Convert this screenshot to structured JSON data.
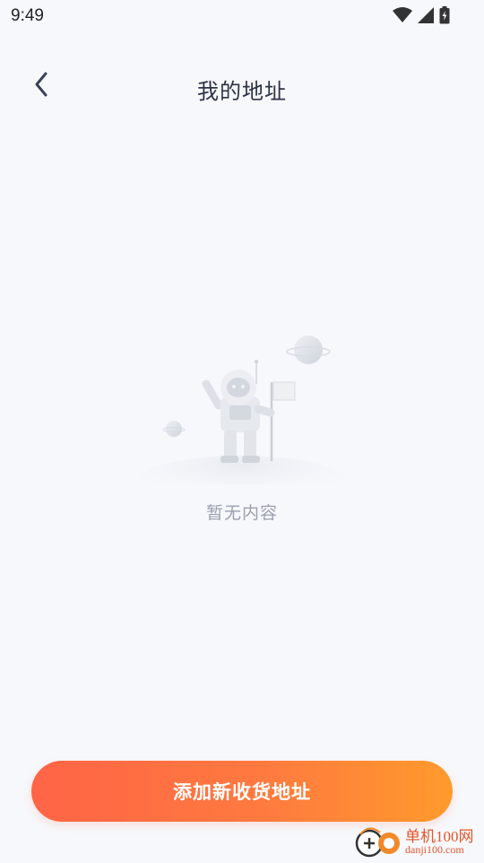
{
  "status_bar": {
    "time": "9:49",
    "icons": [
      "wifi-icon",
      "signal-icon",
      "battery-charging-icon"
    ]
  },
  "header": {
    "title": "我的地址",
    "back_icon": "chevron-left-icon"
  },
  "empty_state": {
    "illustration": "astronaut-on-moon-illustration",
    "message": "暂无内容"
  },
  "footer": {
    "add_button_label": "添加新收货地址"
  },
  "watermark": {
    "site_name": "单机100网",
    "site_url": "danji100.com"
  },
  "colors": {
    "background": "#f7f8fc",
    "title": "#2d3346",
    "empty_text": "#9aa0ad",
    "button_gradient_start": "#ff6446",
    "button_gradient_end": "#ff9a2c"
  }
}
